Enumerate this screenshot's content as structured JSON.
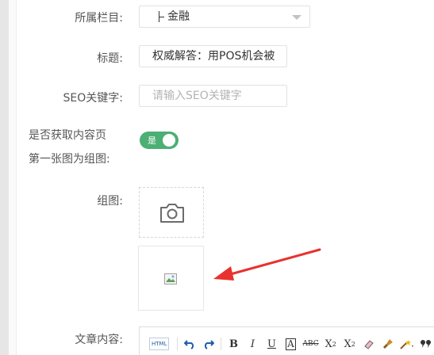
{
  "form": {
    "category": {
      "label": "所属栏目:",
      "value": "金融"
    },
    "title": {
      "label": "标题:",
      "value": "权威解答：用POS机会被"
    },
    "seo": {
      "label": "SEO关键字:",
      "placeholder": "请输入SEO关键字"
    },
    "first_image": {
      "label_line1": "是否获取内容页",
      "label_line2": "第一张图为组图:",
      "toggle_text": "是",
      "on": true
    },
    "gallery": {
      "label": "组图:"
    },
    "content": {
      "label": "文章内容:"
    }
  },
  "editor_toolbar": {
    "html_label": "HTML",
    "items": [
      "B",
      "I",
      "U",
      "A",
      "ABC",
      "X",
      "X"
    ]
  },
  "colors": {
    "toggle_on": "#4caf73",
    "arrow": "#e8322d",
    "editor_icon_blue": "#1e5fa8"
  }
}
